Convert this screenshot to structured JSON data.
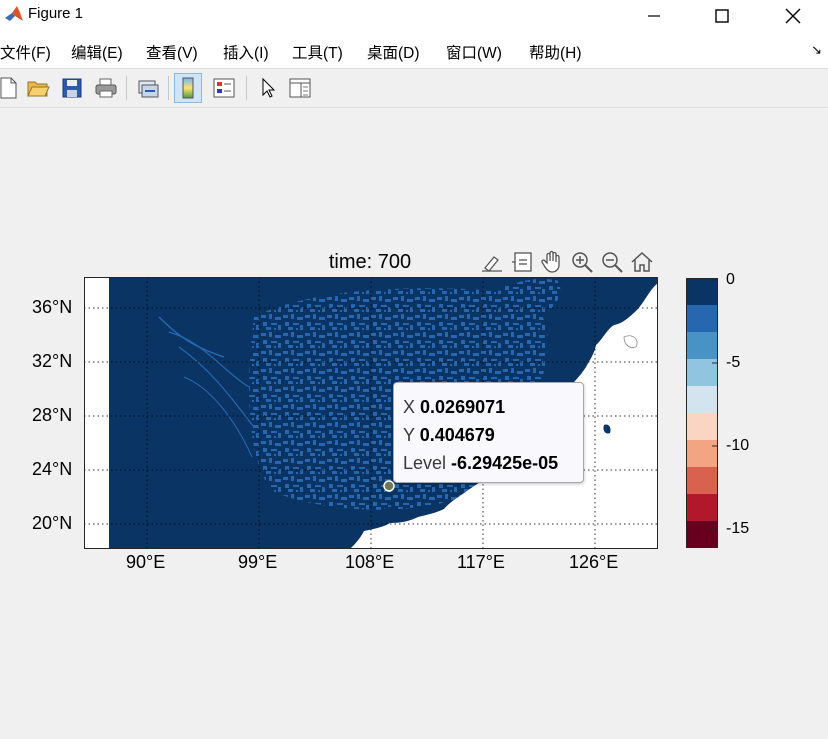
{
  "window": {
    "title": "Figure 1",
    "accent": "#ffffff"
  },
  "menu": [
    "文件(F)",
    "编辑(E)",
    "查看(V)",
    "插入(I)",
    "工具(T)",
    "桌面(D)",
    "窗口(W)",
    "帮助(H)"
  ],
  "menu_arrow": "↘",
  "toolbar": [
    "new-figure-icon",
    "open-file-icon",
    "save-icon",
    "print-icon",
    "link-plot-icon",
    "colorbar-icon",
    "legend-icon",
    "edit-plot-icon",
    "property-inspector-icon"
  ],
  "axes_toolbar": [
    "brush-icon",
    "data-tips-icon",
    "pan-icon",
    "zoom-in-icon",
    "zoom-out-icon",
    "restore-view-icon"
  ],
  "plot": {
    "title": "time: 700",
    "x_ticks": [
      "90°E",
      "99°E",
      "108°E",
      "117°E",
      "126°E"
    ],
    "y_ticks": [
      "36°N",
      "32°N",
      "28°N",
      "24°N",
      "20°N"
    ],
    "land_color": "#0a3464",
    "detail_color": "#2767b0"
  },
  "colorbar": {
    "ticks": [
      "0",
      "-5",
      "-10",
      "-15"
    ],
    "colors": [
      "#0a3464",
      "#2767b0",
      "#4893c6",
      "#91c4df",
      "#d3e4ef",
      "#fbd5c3",
      "#f2a483",
      "#d86150",
      "#b1182b",
      "#67001f"
    ]
  },
  "datatip": {
    "x_label": "X",
    "x_value": "0.0269071",
    "y_label": "Y",
    "y_value": "0.404679",
    "level_label": "Level",
    "level_value": "-6.29425e-05"
  }
}
